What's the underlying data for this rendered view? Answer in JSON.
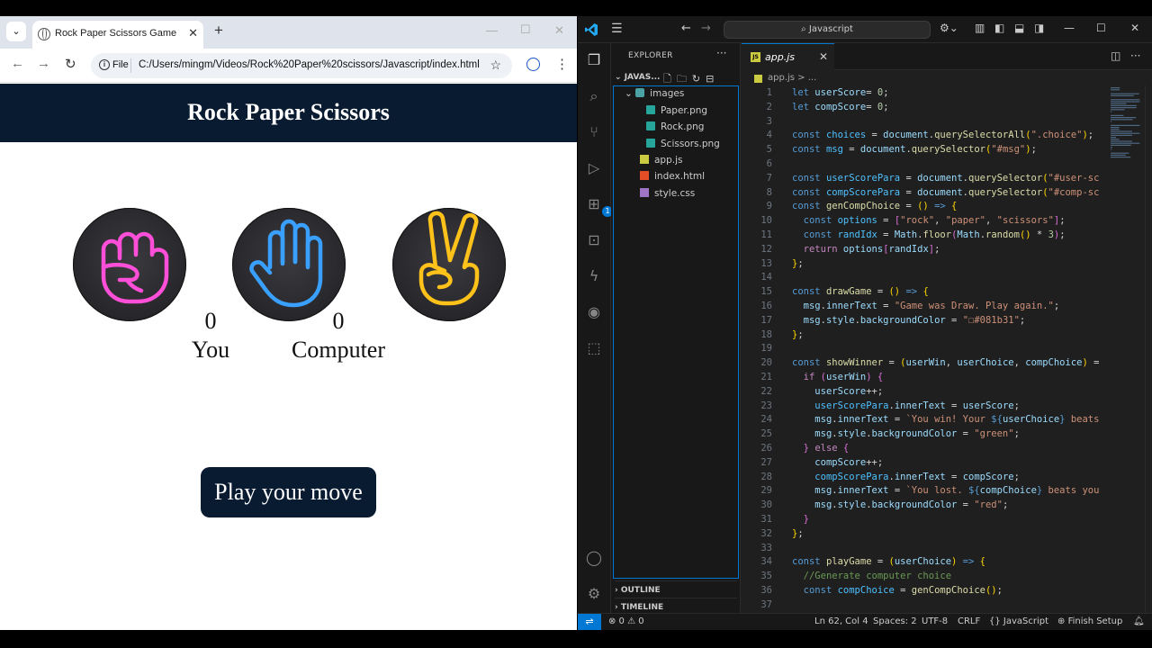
{
  "browser": {
    "tab_title": "Rock Paper Scissors Game",
    "new_tab": "+",
    "omnibox_scheme": "File",
    "url": "C:/Users/mingm/Videos/Rock%20Paper%20scissors/Javascript/index.html"
  },
  "page": {
    "heading": "Rock Paper Scissors",
    "user_score": "0",
    "user_label": "You",
    "comp_score": "0",
    "comp_label": "Computer",
    "play_button": "Play your move",
    "colors": {
      "header": "#081b31",
      "rock": "#ff4fd8",
      "paper": "#3aa0ff",
      "scissors": "#ffc21a"
    }
  },
  "vscode": {
    "search": "Javascript",
    "explorer_title": "EXPLORER",
    "folder": "JAVAS...",
    "tree": {
      "images": "images",
      "paper": "Paper.png",
      "rock": "Rock.png",
      "scissors": "Scissors.png",
      "appjs": "app.js",
      "index": "index.html",
      "style": "style.css"
    },
    "outline": "OUTLINE",
    "timeline": "TIMELINE",
    "active_tab": "app.js",
    "breadcrumb": "app.js > ...",
    "extensions_badge": "1",
    "status": {
      "problems": "⊗ 0 ⚠ 0",
      "position": "Ln 62, Col 4",
      "spaces": "Spaces: 2",
      "encoding": "UTF-8",
      "eol": "CRLF",
      "language": "{} JavaScript",
      "finish": "Finish Setup"
    },
    "line_numbers": [
      "1",
      "2",
      "3",
      "4",
      "5",
      "6",
      "7",
      "8",
      "9",
      "10",
      "11",
      "12",
      "13",
      "14",
      "15",
      "16",
      "17",
      "18",
      "19",
      "20",
      "21",
      "22",
      "23",
      "24",
      "25",
      "26",
      "27",
      "28",
      "29",
      "30",
      "31",
      "32",
      "33",
      "34",
      "35",
      "36",
      "37"
    ],
    "code": [
      [
        [
          "k",
          "let "
        ],
        [
          "v",
          "userScore"
        ],
        [
          "",
          "= "
        ],
        [
          "n",
          "0"
        ],
        [
          "",
          ";"
        ]
      ],
      [
        [
          "k",
          "let "
        ],
        [
          "v",
          "compScore"
        ],
        [
          "",
          "= "
        ],
        [
          "n",
          "0"
        ],
        [
          "",
          ";"
        ]
      ],
      [],
      [
        [
          "k",
          "const "
        ],
        [
          "o",
          "choices"
        ],
        [
          "",
          " = "
        ],
        [
          "v",
          "document"
        ],
        [
          "",
          "."
        ],
        [
          "f",
          "querySelectorAll"
        ],
        [
          "y",
          "("
        ],
        [
          "s",
          "\".choice\""
        ],
        [
          "y",
          ")"
        ],
        [
          "",
          ";"
        ]
      ],
      [
        [
          "k",
          "const "
        ],
        [
          "o",
          "msg"
        ],
        [
          "",
          " = "
        ],
        [
          "v",
          "document"
        ],
        [
          "",
          "."
        ],
        [
          "f",
          "querySelector"
        ],
        [
          "y",
          "("
        ],
        [
          "s",
          "\"#msg\""
        ],
        [
          "y",
          ")"
        ],
        [
          "",
          ";"
        ]
      ],
      [],
      [
        [
          "k",
          "const "
        ],
        [
          "o",
          "userScorePara"
        ],
        [
          "",
          " = "
        ],
        [
          "v",
          "document"
        ],
        [
          "",
          "."
        ],
        [
          "f",
          "querySelector"
        ],
        [
          "y",
          "("
        ],
        [
          "s",
          "\"#user-sc"
        ]
      ],
      [
        [
          "k",
          "const "
        ],
        [
          "o",
          "compScorePara"
        ],
        [
          "",
          " = "
        ],
        [
          "v",
          "document"
        ],
        [
          "",
          "."
        ],
        [
          "f",
          "querySelector"
        ],
        [
          "y",
          "("
        ],
        [
          "s",
          "\"#comp-sc"
        ]
      ],
      [
        [
          "k",
          "const "
        ],
        [
          "f",
          "genCompChoice"
        ],
        [
          "",
          " = "
        ],
        [
          "y",
          "()"
        ],
        [
          "k",
          " => "
        ],
        [
          "y",
          "{"
        ]
      ],
      [
        [
          "",
          "  "
        ],
        [
          "k",
          "const "
        ],
        [
          "o",
          "options"
        ],
        [
          "",
          " = "
        ],
        [
          "p",
          "["
        ],
        [
          "s",
          "\"rock\""
        ],
        [
          "",
          ", "
        ],
        [
          "s",
          "\"paper\""
        ],
        [
          "",
          ", "
        ],
        [
          "s",
          "\"scissors\""
        ],
        [
          "p",
          "]"
        ],
        [
          "",
          ";"
        ]
      ],
      [
        [
          "",
          "  "
        ],
        [
          "k",
          "const "
        ],
        [
          "o",
          "randIdx"
        ],
        [
          "",
          " = "
        ],
        [
          "v",
          "Math"
        ],
        [
          "",
          "."
        ],
        [
          "f",
          "floor"
        ],
        [
          "p",
          "("
        ],
        [
          "v",
          "Math"
        ],
        [
          "",
          "."
        ],
        [
          "f",
          "random"
        ],
        [
          "y",
          "()"
        ],
        [
          "",
          " * "
        ],
        [
          "n",
          "3"
        ],
        [
          "p",
          ")"
        ],
        [
          "",
          ";"
        ]
      ],
      [
        [
          "",
          "  "
        ],
        [
          "kc",
          "return "
        ],
        [
          "v",
          "options"
        ],
        [
          "p",
          "["
        ],
        [
          "v",
          "randIdx"
        ],
        [
          "p",
          "]"
        ],
        [
          "",
          ";"
        ]
      ],
      [
        [
          "y",
          "}"
        ],
        [
          "",
          ";"
        ]
      ],
      [],
      [
        [
          "k",
          "const "
        ],
        [
          "f",
          "drawGame"
        ],
        [
          "",
          " = "
        ],
        [
          "y",
          "()"
        ],
        [
          "k",
          " => "
        ],
        [
          "y",
          "{"
        ]
      ],
      [
        [
          "",
          "  "
        ],
        [
          "v",
          "msg"
        ],
        [
          "",
          "."
        ],
        [
          "v",
          "innerText"
        ],
        [
          "",
          " = "
        ],
        [
          "s",
          "\"Game was Draw. Play again.\""
        ],
        [
          "",
          ";"
        ]
      ],
      [
        [
          "",
          "  "
        ],
        [
          "v",
          "msg"
        ],
        [
          "",
          "."
        ],
        [
          "v",
          "style"
        ],
        [
          "",
          "."
        ],
        [
          "v",
          "backgroundColor"
        ],
        [
          "",
          " = "
        ],
        [
          "s",
          "\"☐#081b31\""
        ],
        [
          "",
          ";"
        ]
      ],
      [
        [
          "y",
          "}"
        ],
        [
          "",
          ";"
        ]
      ],
      [],
      [
        [
          "k",
          "const "
        ],
        [
          "f",
          "showWinner"
        ],
        [
          "",
          " = "
        ],
        [
          "y",
          "("
        ],
        [
          "v",
          "userWin"
        ],
        [
          "",
          ", "
        ],
        [
          "v",
          "userChoice"
        ],
        [
          "",
          ", "
        ],
        [
          "v",
          "compChoice"
        ],
        [
          "y",
          ")"
        ],
        [
          "",
          " ="
        ]
      ],
      [
        [
          "",
          "  "
        ],
        [
          "kc",
          "if "
        ],
        [
          "p",
          "("
        ],
        [
          "v",
          "userWin"
        ],
        [
          "p",
          ") {"
        ]
      ],
      [
        [
          "",
          "    "
        ],
        [
          "v",
          "userScore"
        ],
        [
          "",
          "++;"
        ]
      ],
      [
        [
          "",
          "    "
        ],
        [
          "o",
          "userScorePara"
        ],
        [
          "",
          "."
        ],
        [
          "v",
          "innerText"
        ],
        [
          "",
          " = "
        ],
        [
          "v",
          "userScore"
        ],
        [
          "",
          ";"
        ]
      ],
      [
        [
          "",
          "    "
        ],
        [
          "v",
          "msg"
        ],
        [
          "",
          "."
        ],
        [
          "v",
          "innerText"
        ],
        [
          "",
          " = "
        ],
        [
          "s",
          "`You win! Your "
        ],
        [
          "k",
          "${"
        ],
        [
          "v",
          "userChoice"
        ],
        [
          "k",
          "}"
        ],
        [
          "s",
          " beats"
        ]
      ],
      [
        [
          "",
          "    "
        ],
        [
          "v",
          "msg"
        ],
        [
          "",
          "."
        ],
        [
          "v",
          "style"
        ],
        [
          "",
          "."
        ],
        [
          "v",
          "backgroundColor"
        ],
        [
          "",
          " = "
        ],
        [
          "s",
          "\"green\""
        ],
        [
          "",
          ";"
        ]
      ],
      [
        [
          "",
          "  "
        ],
        [
          "p",
          "} "
        ],
        [
          "kc",
          "else "
        ],
        [
          "p",
          "{"
        ]
      ],
      [
        [
          "",
          "    "
        ],
        [
          "v",
          "compScore"
        ],
        [
          "",
          "++;"
        ]
      ],
      [
        [
          "",
          "    "
        ],
        [
          "o",
          "compScorePara"
        ],
        [
          "",
          "."
        ],
        [
          "v",
          "innerText"
        ],
        [
          "",
          " = "
        ],
        [
          "v",
          "compScore"
        ],
        [
          "",
          ";"
        ]
      ],
      [
        [
          "",
          "    "
        ],
        [
          "v",
          "msg"
        ],
        [
          "",
          "."
        ],
        [
          "v",
          "innerText"
        ],
        [
          "",
          " = "
        ],
        [
          "s",
          "`You lost. "
        ],
        [
          "k",
          "${"
        ],
        [
          "v",
          "compChoice"
        ],
        [
          "k",
          "}"
        ],
        [
          "s",
          " beats you"
        ]
      ],
      [
        [
          "",
          "    "
        ],
        [
          "v",
          "msg"
        ],
        [
          "",
          "."
        ],
        [
          "v",
          "style"
        ],
        [
          "",
          "."
        ],
        [
          "v",
          "backgroundColor"
        ],
        [
          "",
          " = "
        ],
        [
          "s",
          "\"red\""
        ],
        [
          "",
          ";"
        ]
      ],
      [
        [
          "",
          "  "
        ],
        [
          "p",
          "}"
        ]
      ],
      [
        [
          "y",
          "}"
        ],
        [
          "",
          ";"
        ]
      ],
      [],
      [
        [
          "k",
          "const "
        ],
        [
          "f",
          "playGame"
        ],
        [
          "",
          " = "
        ],
        [
          "y",
          "("
        ],
        [
          "v",
          "userChoice"
        ],
        [
          "y",
          ")"
        ],
        [
          "k",
          " => "
        ],
        [
          "y",
          "{"
        ]
      ],
      [
        [
          "",
          "  "
        ],
        [
          "c",
          "//Generate computer choice"
        ]
      ],
      [
        [
          "",
          "  "
        ],
        [
          "k",
          "const "
        ],
        [
          "o",
          "compChoice"
        ],
        [
          "",
          " = "
        ],
        [
          "f",
          "genCompChoice"
        ],
        [
          "y",
          "()"
        ],
        [
          "",
          ";"
        ]
      ],
      []
    ]
  }
}
